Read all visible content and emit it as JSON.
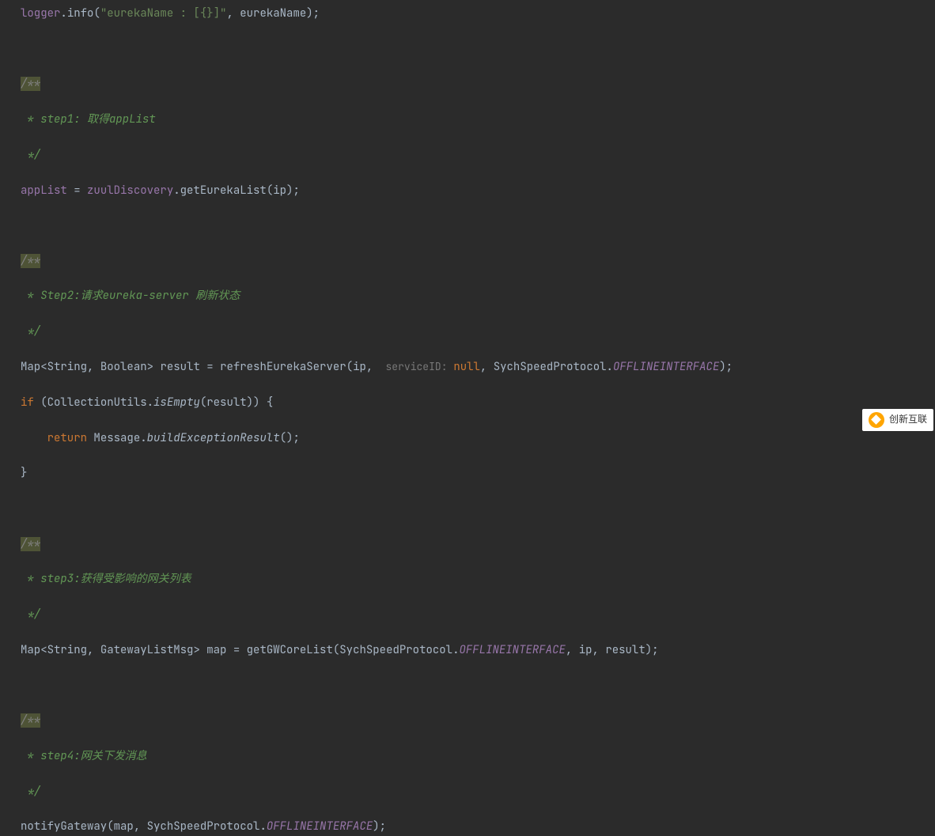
{
  "code": {
    "line1_logger": "logger",
    "line1_info": "info",
    "line1_string": "\"eurekaName : [{}]\"",
    "line1_param": "eurekaName",
    "comment1_start": "/**",
    "comment1_body": " * step1: 取得appList",
    "comment1_end": " */",
    "line2_applist": "appList",
    "line2_zuul": "zuulDiscovery",
    "line2_method": "getEurekaList",
    "line2_param": "ip",
    "comment2_start": "/**",
    "comment2_body": " * Step2:请求eureka-server 刷新状态",
    "comment2_end": " */",
    "line3_map": "Map",
    "line3_string": "String",
    "line3_bool": "Boolean",
    "line3_result": "result",
    "line3_refresh": "refreshEurekaServer",
    "line3_ip": "ip",
    "line3_hint": " serviceID: ",
    "line3_null": "null",
    "line3_protocol": "SychSpeedProtocol",
    "line3_offline": "OFFLINEINTERFACE",
    "line4_if": "if",
    "line4_cu": "CollectionUtils",
    "line4_isempty": "isEmpty",
    "line4_result": "result",
    "line5_return": "return",
    "line5_msg": "Message",
    "line5_build": "buildExceptionResult",
    "line6_brace": "}",
    "comment3_start": "/**",
    "comment3_body": " * step3:获得受影响的网关列表",
    "comment3_end": " */",
    "line7_map": "Map",
    "line7_string": "String",
    "line7_gwmsg": "GatewayListMsg",
    "line7_mapvar": "map",
    "line7_getgw": "getGWCoreList",
    "line7_protocol": "SychSpeedProtocol",
    "line7_offline": "OFFLINEINTERFACE",
    "line7_ip": "ip",
    "line7_result": "result",
    "comment4_start": "/**",
    "comment4_body": " * step4:网关下发消息",
    "comment4_end": " */",
    "line8_notify": "notifyGateway",
    "line8_map": "map",
    "line8_protocol": "SychSpeedProtocol",
    "line8_offline": "OFFLINEINTERFACE"
  },
  "watermark": {
    "text": "创新互联"
  }
}
